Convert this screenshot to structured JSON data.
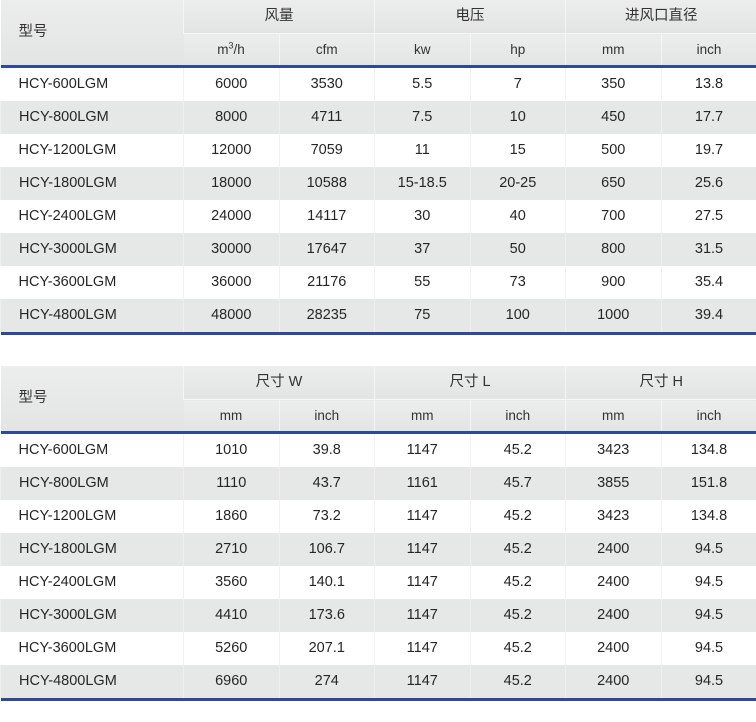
{
  "tables": [
    {
      "name": "airflow-voltage-inlet-table",
      "model_header": "型号",
      "groups": [
        {
          "label": "风量",
          "units": [
            "m3/h",
            "cfm"
          ]
        },
        {
          "label": "电压",
          "units": [
            "kw",
            "hp"
          ]
        },
        {
          "label": "进风口直径",
          "units": [
            "mm",
            "inch"
          ]
        }
      ],
      "sub_headers": [
        "m3/h",
        "cfm",
        "kw",
        "hp",
        "mm",
        "inch"
      ],
      "rows": [
        {
          "model": "HCY-600LGM",
          "values": [
            "6000",
            "3530",
            "5.5",
            "7",
            "350",
            "13.8"
          ]
        },
        {
          "model": "HCY-800LGM",
          "values": [
            "8000",
            "4711",
            "7.5",
            "10",
            "450",
            "17.7"
          ]
        },
        {
          "model": "HCY-1200LGM",
          "values": [
            "12000",
            "7059",
            "11",
            "15",
            "500",
            "19.7"
          ]
        },
        {
          "model": "HCY-1800LGM",
          "values": [
            "18000",
            "10588",
            "15-18.5",
            "20-25",
            "650",
            "25.6"
          ]
        },
        {
          "model": "HCY-2400LGM",
          "values": [
            "24000",
            "14117",
            "30",
            "40",
            "700",
            "27.5"
          ]
        },
        {
          "model": "HCY-3000LGM",
          "values": [
            "30000",
            "17647",
            "37",
            "50",
            "800",
            "31.5"
          ]
        },
        {
          "model": "HCY-3600LGM",
          "values": [
            "36000",
            "21176",
            "55",
            "73",
            "900",
            "35.4"
          ]
        },
        {
          "model": "HCY-4800LGM",
          "values": [
            "48000",
            "28235",
            "75",
            "100",
            "1000",
            "39.4"
          ]
        }
      ]
    },
    {
      "name": "dimensions-table",
      "model_header": "型号",
      "groups": [
        {
          "label": "尺寸 W",
          "units": [
            "mm",
            "inch"
          ]
        },
        {
          "label": "尺寸 L",
          "units": [
            "mm",
            "inch"
          ]
        },
        {
          "label": "尺寸 H",
          "units": [
            "mm",
            "inch"
          ]
        }
      ],
      "sub_headers": [
        "mm",
        "inch",
        "mm",
        "inch",
        "mm",
        "inch"
      ],
      "rows": [
        {
          "model": "HCY-600LGM",
          "values": [
            "1010",
            "39.8",
            "1147",
            "45.2",
            "3423",
            "134.8"
          ]
        },
        {
          "model": "HCY-800LGM",
          "values": [
            "1110",
            "43.7",
            "1161",
            "45.7",
            "3855",
            "151.8"
          ]
        },
        {
          "model": "HCY-1200LGM",
          "values": [
            "1860",
            "73.2",
            "1147",
            "45.2",
            "3423",
            "134.8"
          ]
        },
        {
          "model": "HCY-1800LGM",
          "values": [
            "2710",
            "106.7",
            "1147",
            "45.2",
            "2400",
            "94.5"
          ]
        },
        {
          "model": "HCY-2400LGM",
          "values": [
            "3560",
            "140.1",
            "1147",
            "45.2",
            "2400",
            "94.5"
          ]
        },
        {
          "model": "HCY-3000LGM",
          "values": [
            "4410",
            "173.6",
            "1147",
            "45.2",
            "2400",
            "94.5"
          ]
        },
        {
          "model": "HCY-3600LGM",
          "values": [
            "5260",
            "207.1",
            "1147",
            "45.2",
            "2400",
            "94.5"
          ]
        },
        {
          "model": "HCY-4800LGM",
          "values": [
            "6960",
            "274",
            "1147",
            "45.2",
            "2400",
            "94.5"
          ]
        }
      ]
    }
  ],
  "colors": {
    "rule": "#2f4899",
    "header_bg": "#e8e9e9",
    "stripe_bg": "#e6e7e7",
    "text": "#262626"
  }
}
